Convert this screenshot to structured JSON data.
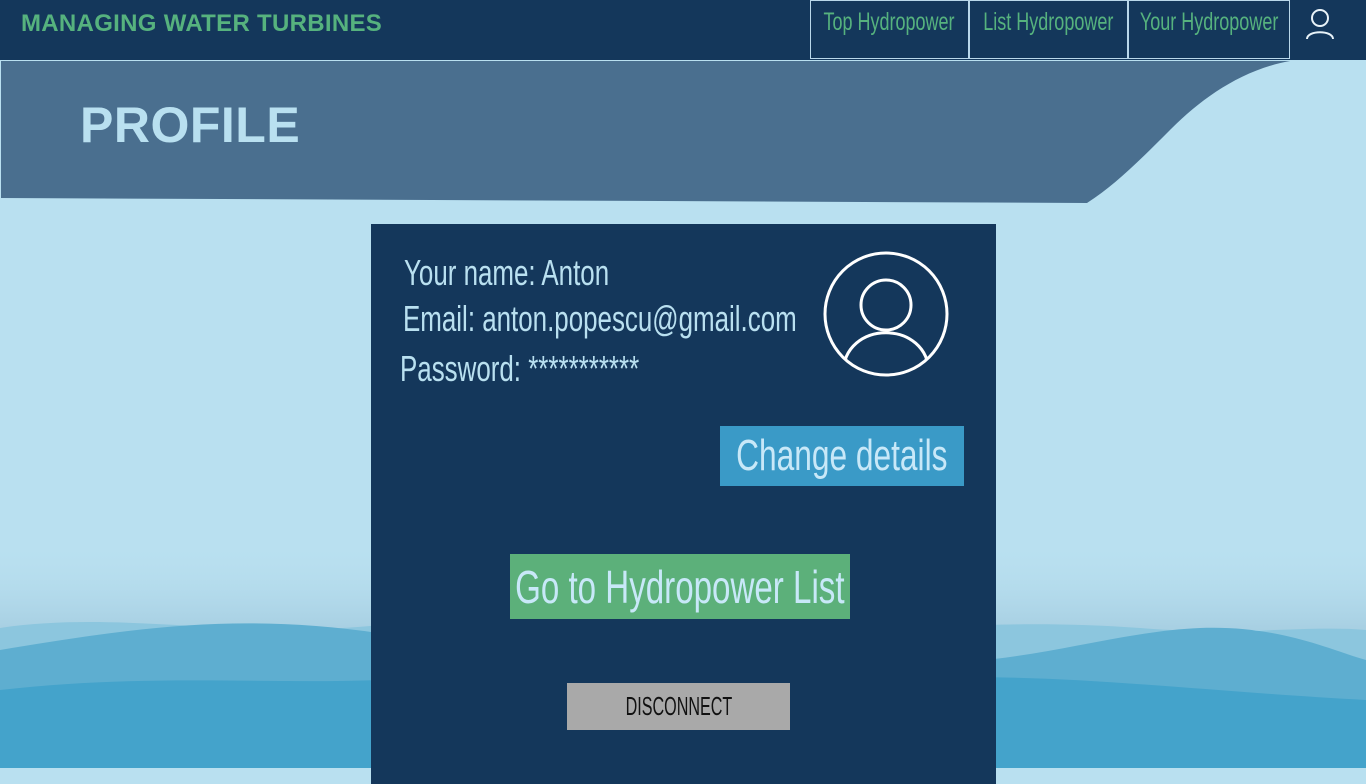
{
  "header": {
    "brand": "MANAGING WATER TURBINES",
    "nav": [
      {
        "label": "Top Hydropower"
      },
      {
        "label": "List Hydropower"
      },
      {
        "label": "Your Hydropower"
      }
    ],
    "user_icon": "user-icon"
  },
  "banner": {
    "title": "PROFILE"
  },
  "profile": {
    "name_label": "Your name: ",
    "name_value": "Anton",
    "email_label": "Email: ",
    "email_value": "anton.popescu@gmail.com",
    "password_label": "Password: ",
    "password_value": "***********",
    "avatar_icon": "user-avatar-icon"
  },
  "actions": {
    "change_details": "Change details",
    "go_to_list": "Go to Hydropower List",
    "disconnect": "DISCONNECT"
  },
  "colors": {
    "header_bg": "#14375b",
    "brand_green": "#56b27e",
    "banner_bg": "#4a6f8f",
    "page_bg": "#b9e0f0",
    "wave_blue": "#44a3cb",
    "change_btn": "#3a9ac7",
    "list_btn": "#5cb07a",
    "disconnect_btn": "#a9a9a9"
  }
}
